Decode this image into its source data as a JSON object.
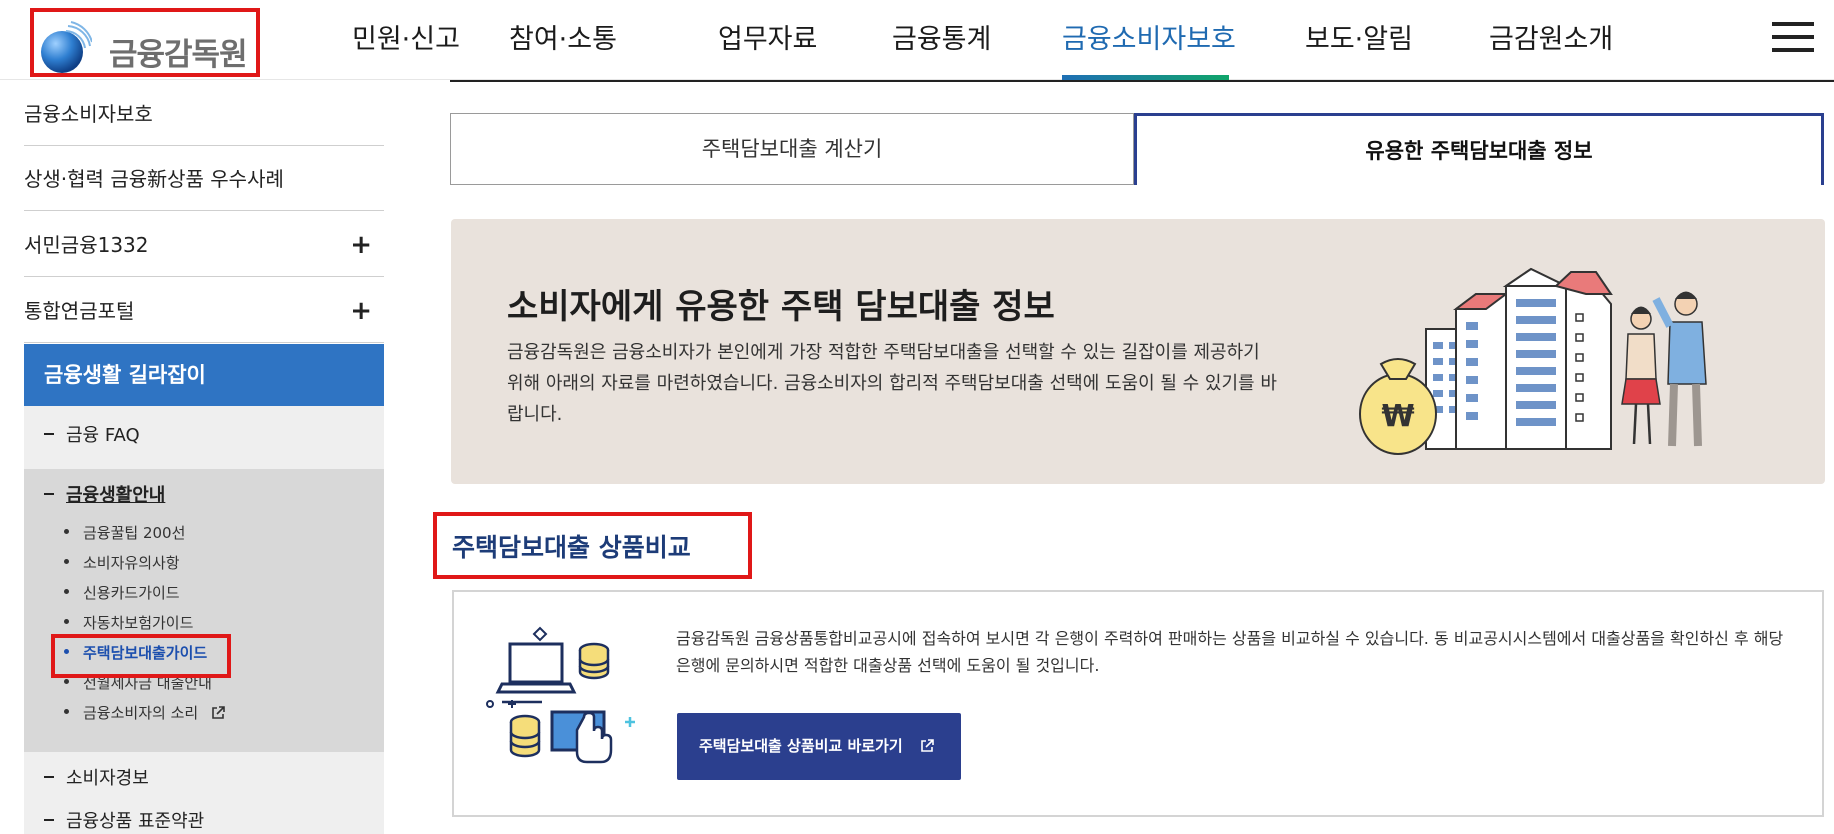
{
  "header": {
    "logo_text": "금융감독원",
    "nav": [
      {
        "label": "민원·신고"
      },
      {
        "label": "참여·소통"
      },
      {
        "label": "업무자료"
      },
      {
        "label": "금융통계"
      },
      {
        "label": "금융소비자보호"
      },
      {
        "label": "보도·알림"
      },
      {
        "label": "금감원소개"
      }
    ],
    "active_nav": "금융소비자보호",
    "menu_icon": "hamburger-menu-icon"
  },
  "sidebar": {
    "links": [
      {
        "label": "금융소비자보호",
        "expandable": false
      },
      {
        "label": "상생·협력 금융新상품 우수사례",
        "expandable": false
      },
      {
        "label": "서민금융1332",
        "expandable": true,
        "toggle": "+"
      },
      {
        "label": "통합연금포털",
        "expandable": true,
        "toggle": "+"
      }
    ],
    "active_section": "금융생활 길라잡이",
    "sub_items": [
      {
        "label": "금융 FAQ"
      },
      {
        "label": "금융생활안내"
      },
      {
        "label": "소비자경보"
      },
      {
        "label": "금융상품 표준약관"
      }
    ],
    "leaves": [
      {
        "label": "금융꿀팁 200선"
      },
      {
        "label": "소비자유의사항"
      },
      {
        "label": "신용카드가이드"
      },
      {
        "label": "자동차보험가이드"
      },
      {
        "label": "주택담보대출가이드"
      },
      {
        "label": "전월세자금 대출안내"
      },
      {
        "label": "금융소비자의 소리"
      }
    ],
    "current_leaf": "주택담보대출가이드"
  },
  "tabs": [
    {
      "label": "주택담보대출 계산기",
      "selected": false
    },
    {
      "label": "유용한 주택담보대출 정보",
      "selected": true
    }
  ],
  "banner": {
    "title": "소비자에게 유용한 주택 담보대출 정보",
    "description": "금융감독원은 금융소비자가 본인에게 가장 적합한 주택담보대출을 선택할 수 있는 길잡이를 제공하기 위해 아래의 자료를 마련하였습니다. 금융소비자의 합리적 주택담보대출 선택에 도움이 될 수 있기를 바랍니다.",
    "art_symbol": "₩"
  },
  "compare": {
    "section_title": "주택담보대출 상품비교",
    "description": "금융감독원 금융상품통합비교공시에 접속하여 보시면 각 은행이 주력하여 판매하는 상품을 비교하실 수 있습니다. 동 비교공시시스템에서 대출상품을 확인하신 후 해당은행에 문의하시면 적합한 대출상품 선택에 도움이 될 것입니다.",
    "button_label": "주택담보대출 상품비교 바로가기"
  },
  "colors": {
    "brand_blue": "#2f74c3",
    "button_navy": "#2b3f8e",
    "active_nav": "#1f6ab1",
    "highlight_red": "#e01818",
    "banner_bg": "#e9e2dc"
  }
}
